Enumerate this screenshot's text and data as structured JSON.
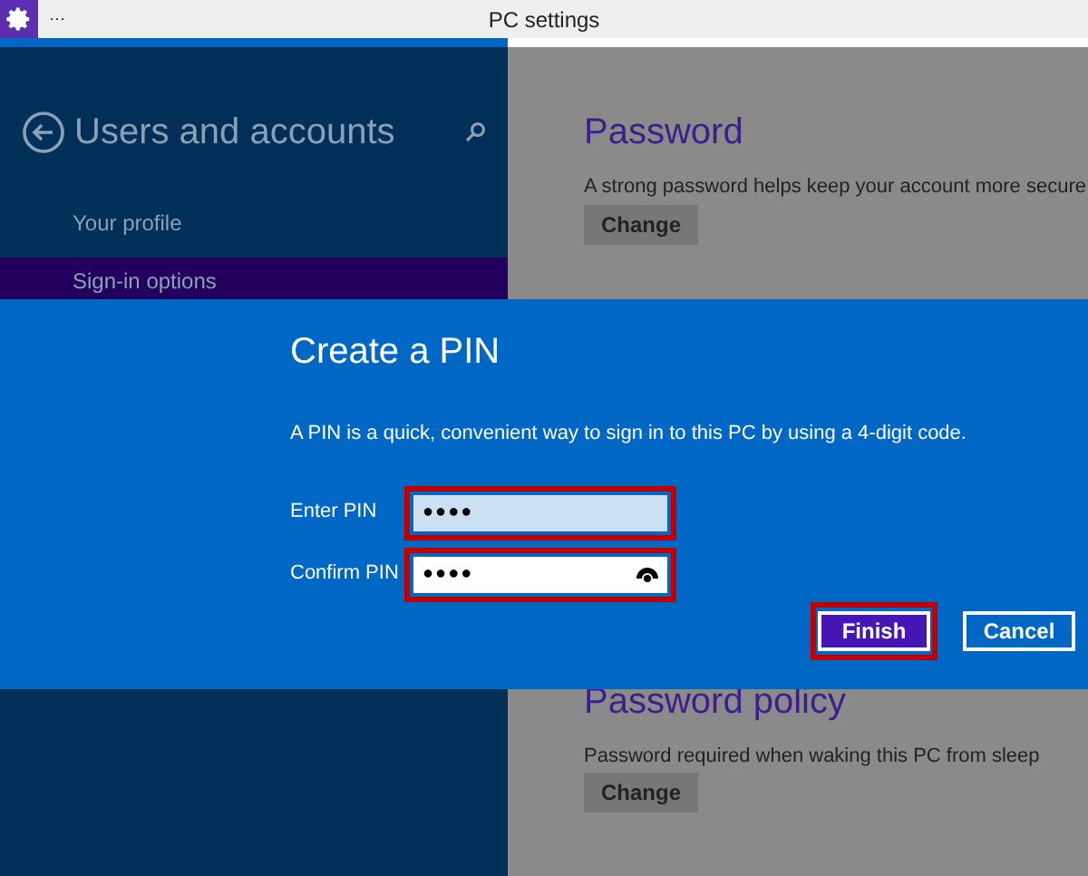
{
  "window": {
    "title": "PC settings",
    "menu_glyph": "···"
  },
  "sidebar": {
    "title": "Users and accounts",
    "items": [
      {
        "label": "Your profile",
        "selected": false
      },
      {
        "label": "Sign-in options",
        "selected": true
      }
    ]
  },
  "sections": [
    {
      "heading": "Password",
      "description": "A strong password helps keep your account more secure",
      "button": "Change"
    },
    {
      "heading": "Password policy",
      "description": "Password required when waking this PC from sleep",
      "button": "Change"
    }
  ],
  "dialog": {
    "title": "Create a PIN",
    "description": "A PIN is a quick, convenient way to sign in to this PC by using a 4-digit code.",
    "fields": [
      {
        "label": "Enter PIN",
        "value": "●●●●",
        "focused": true,
        "highlighted": true,
        "reveal_icon": false
      },
      {
        "label": "Confirm PIN",
        "value": "●●●●",
        "focused": false,
        "highlighted": true,
        "reveal_icon": true
      }
    ],
    "buttons": [
      {
        "label": "Finish",
        "kind": "primary",
        "highlighted": true
      },
      {
        "label": "Cancel",
        "kind": "secondary",
        "highlighted": false
      }
    ]
  }
}
